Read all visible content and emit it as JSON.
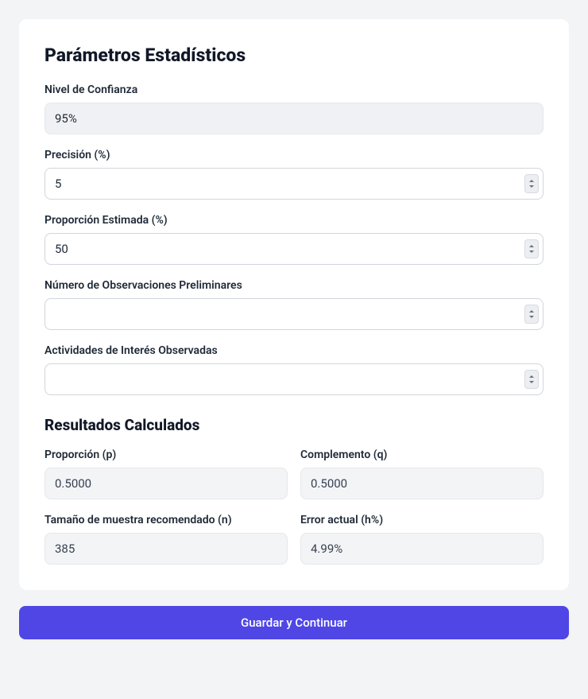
{
  "params": {
    "title": "Parámetros Estadísticos",
    "confidence": {
      "label": "Nivel de Confianza",
      "value": "95%"
    },
    "precision": {
      "label": "Precisión (%)",
      "value": "5"
    },
    "proportion": {
      "label": "Proporción Estimada (%)",
      "value": "50"
    },
    "preliminary": {
      "label": "Número de Observaciones Preliminares",
      "value": ""
    },
    "activities": {
      "label": "Actividades de Interés Observadas",
      "value": ""
    }
  },
  "results": {
    "title": "Resultados Calculados",
    "p": {
      "label": "Proporción (p)",
      "value": "0.5000"
    },
    "q": {
      "label": "Complemento (q)",
      "value": "0.5000"
    },
    "n": {
      "label": "Tamaño de muestra recomendado (n)",
      "value": "385"
    },
    "h": {
      "label": "Error actual (h%)",
      "value": "4.99%"
    }
  },
  "actions": {
    "submit": "Guardar y Continuar"
  }
}
